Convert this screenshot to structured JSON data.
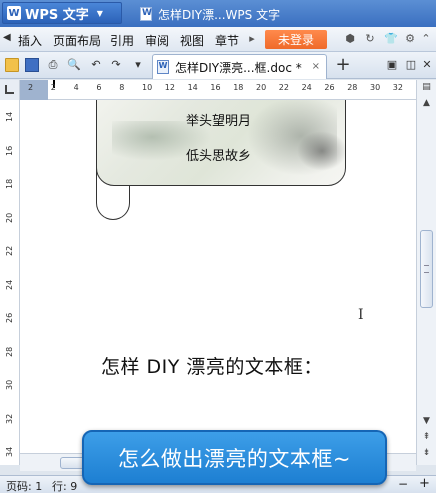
{
  "window": {
    "app_name": "WPS 文字",
    "title": "怎样DIY漂...WPS 文字"
  },
  "menu": {
    "items": [
      "插入",
      "页面布局",
      "引用",
      "审阅",
      "视图",
      "章节"
    ],
    "login_label": "未登录"
  },
  "tabs": {
    "active_label": "怎样DIY漂亮...框.doc *",
    "close_glyph": "×",
    "new_tab_glyph": "+"
  },
  "ruler": {
    "h_ticks": [
      "2",
      "2",
      "4",
      "6",
      "8",
      "10",
      "12",
      "14",
      "16",
      "18",
      "20",
      "22",
      "24",
      "26",
      "28",
      "30",
      "32"
    ],
    "v_ticks": [
      "14",
      "16",
      "18",
      "20",
      "22",
      "24",
      "26",
      "28",
      "30",
      "32",
      "34"
    ]
  },
  "document": {
    "poem_line_1": "举头望明月",
    "poem_line_2": "低头思故乡",
    "heading": "怎样 DIY 漂亮的文本框："
  },
  "status": {
    "page": "页码: 1",
    "line": "行: 9"
  },
  "overlay": {
    "caption": "怎么做出漂亮的文本框~"
  },
  "icons": [
    "app-logo",
    "dropdown-arrow",
    "doc-icon",
    "folder-open-icon",
    "save-icon",
    "print-icon",
    "preview-icon",
    "undo-icon",
    "redo-icon",
    "tab-doc-icon",
    "close-icon",
    "text-cursor-icon",
    "scroll-up-icon",
    "scroll-down-icon"
  ],
  "colors": {
    "titlebar": "#3a6fc0",
    "login_button": "#ef6a2a",
    "caption_bg": "#1d7fd2"
  }
}
